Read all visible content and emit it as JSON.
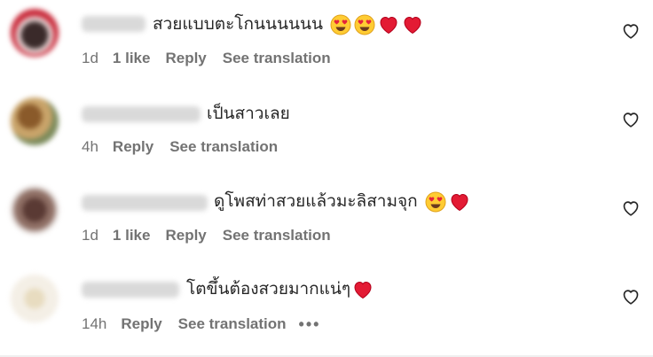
{
  "comments": [
    {
      "text": "สวยแบบตะโกนนนนนน",
      "time": "1d",
      "likes": "1 like",
      "reply": "Reply",
      "translation": "See translation",
      "emojis": [
        "heart-eyes-emoji",
        "heart-eyes-emoji",
        "red-heart-emoji",
        "red-heart-emoji"
      ]
    },
    {
      "text": "เป็นสาวเลย",
      "time": "4h",
      "likes": "",
      "reply": "Reply",
      "translation": "See translation",
      "emojis": []
    },
    {
      "text": "ดูโพสท่าสวยแล้วมะลิสามจุก",
      "time": "1d",
      "likes": "1 like",
      "reply": "Reply",
      "translation": "See translation",
      "emojis": [
        "heart-eyes-emoji",
        "red-heart-emoji"
      ]
    },
    {
      "text": "โตขึ้นต้องสวยมากแน่ๆ",
      "time": "14h",
      "likes": "",
      "reply": "Reply",
      "translation": "See translation",
      "more": "•••",
      "emojis": [
        "red-heart-emoji"
      ]
    }
  ],
  "icons": {
    "like": "heart-outline-icon"
  },
  "colors": {
    "text": "#262626",
    "meta": "#737373",
    "heart": "#ed1c3a",
    "emoji_face": "#ffcc33"
  }
}
